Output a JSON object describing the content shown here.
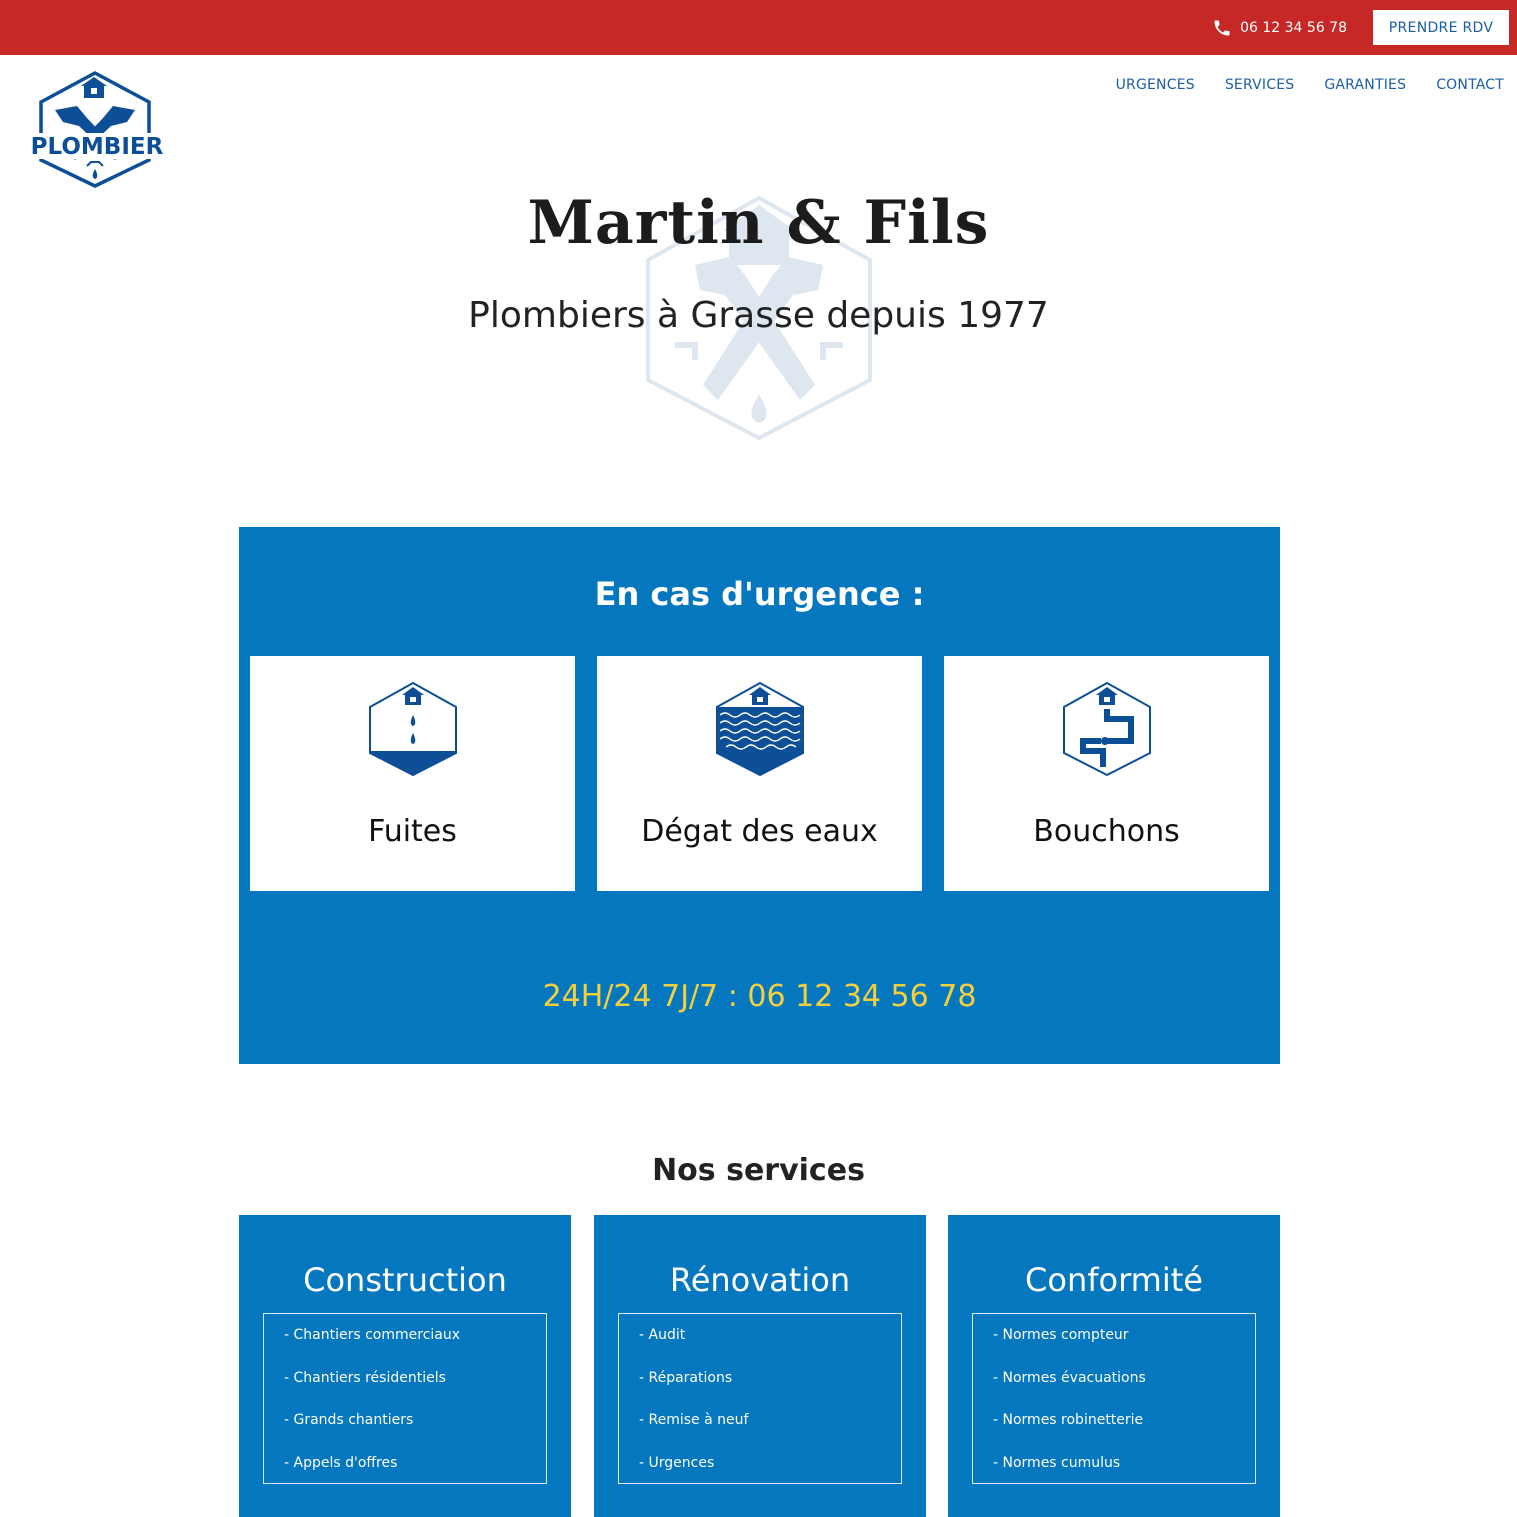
{
  "topbar": {
    "phone": "06 12 34 56 78",
    "rdv_label": "PRENDRE RDV",
    "phone_icon": "phone-icon"
  },
  "header": {
    "logo_text": "PLOMBIER",
    "nav": [
      "URGENCES",
      "SERVICES",
      "GARANTIES",
      "CONTACT"
    ]
  },
  "hero": {
    "title": "Martin & Fils",
    "subtitle": "Plombiers à Grasse depuis 1977"
  },
  "urgences": {
    "title": "En cas d'urgence :",
    "cards": [
      {
        "label": "Fuites",
        "icon": "water-drop-icon"
      },
      {
        "label": "Dégat des eaux",
        "icon": "flood-icon"
      },
      {
        "label": "Bouchons",
        "icon": "pipe-icon"
      }
    ],
    "phone_line": "24H/24 7J/7 : 06 12 34 56 78"
  },
  "services": {
    "title": "Nos services",
    "items": [
      {
        "title": "Construction",
        "list": [
          "- Chantiers commerciaux",
          "- Chantiers résidentiels",
          "- Grands chantiers",
          "- Appels d'offres"
        ]
      },
      {
        "title": "Rénovation",
        "list": [
          "- Audit",
          "- Réparations",
          "- Remise à neuf",
          "- Urgences"
        ]
      },
      {
        "title": "Conformité",
        "list": [
          "- Normes compteur",
          "- Normes évacuations",
          "- Normes robinetterie",
          "- Normes cumulus"
        ]
      }
    ]
  },
  "colors": {
    "topbar_red": "#c62828",
    "brand_blue": "#0477be",
    "nav_blue": "#1a5fa6",
    "accent_yellow": "#f4d03f"
  }
}
